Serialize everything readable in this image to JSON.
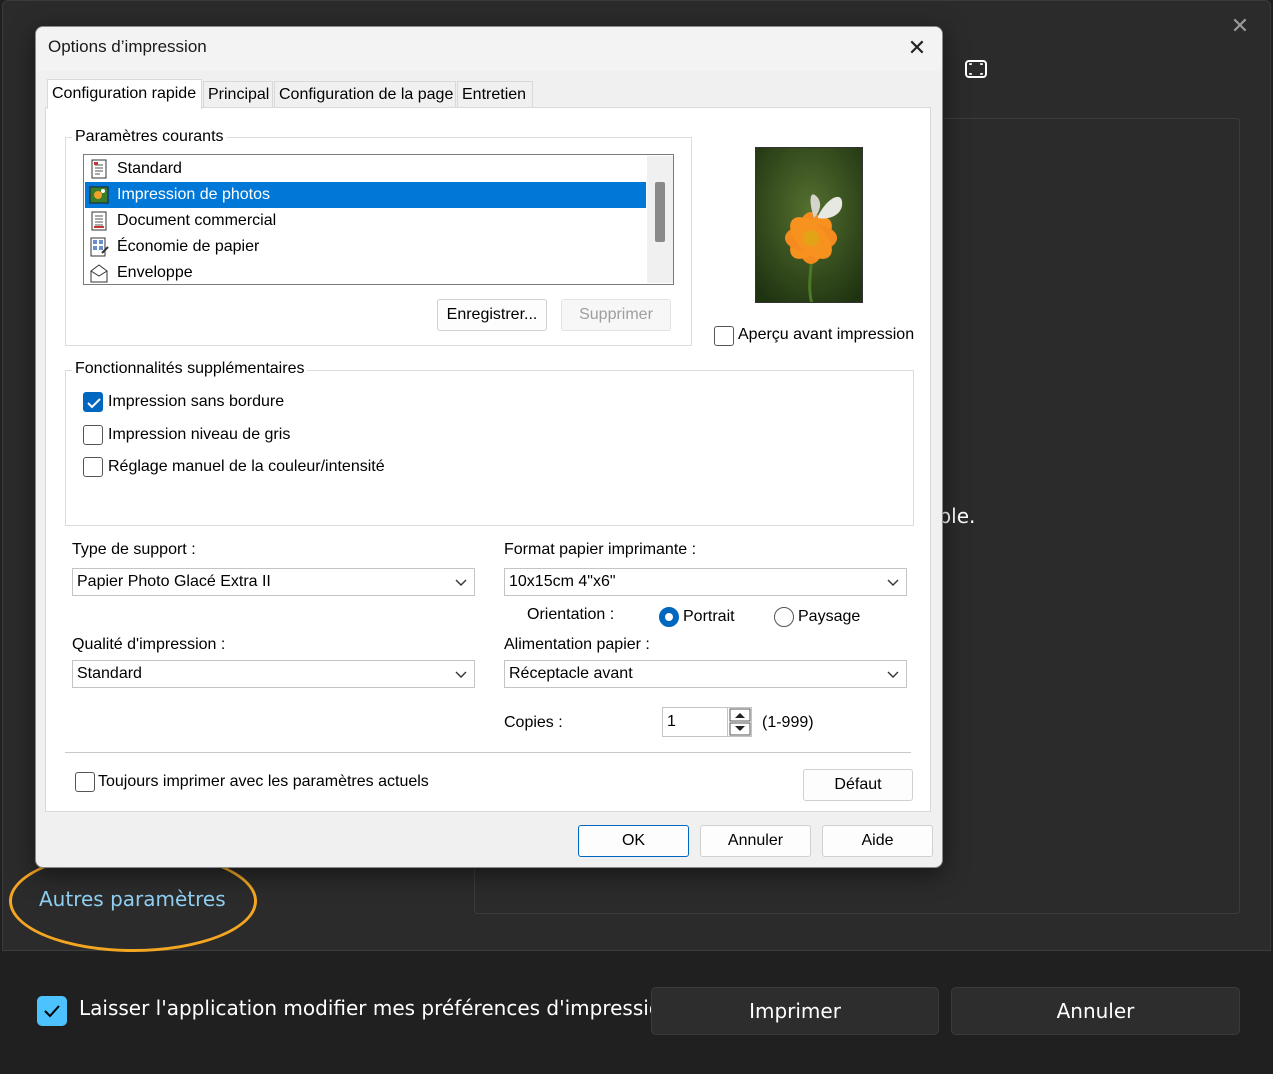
{
  "background": {
    "partial_message": "onible.",
    "other_settings_link": "Autres paramètres",
    "allow_app_label": "Laisser l'application modifier mes préférences d'impression",
    "print_button": "Imprimer",
    "cancel_button": "Annuler",
    "accent_color": "#4cc2ff",
    "highlight_color": "#f4a623"
  },
  "dialog": {
    "title": "Options d’impression",
    "tabs": [
      {
        "label": "Configuration rapide",
        "active": true
      },
      {
        "label": "Principal",
        "active": false
      },
      {
        "label": "Configuration de la page",
        "active": false
      },
      {
        "label": "Entretien",
        "active": false
      }
    ],
    "current_settings": {
      "group_label": "Paramètres courants",
      "items": [
        {
          "label": "Standard",
          "icon": "document-icon",
          "selected": false
        },
        {
          "label": "Impression de photos",
          "icon": "photo-icon",
          "selected": true
        },
        {
          "label": "Document commercial",
          "icon": "business-document-icon",
          "selected": false
        },
        {
          "label": "Économie de papier",
          "icon": "paper-saving-icon",
          "selected": false
        },
        {
          "label": "Enveloppe",
          "icon": "envelope-icon",
          "selected": false
        }
      ],
      "save_button": "Enregistrer...",
      "delete_button": "Supprimer"
    },
    "preview_checkbox": {
      "label": "Aperçu avant impression",
      "checked": false
    },
    "features": {
      "group_label": "Fonctionnalités supplémentaires",
      "items": [
        {
          "label": "Impression sans bordure",
          "checked": true
        },
        {
          "label": "Impression niveau de gris",
          "checked": false
        },
        {
          "label": "Réglage manuel de la couleur/intensité",
          "checked": false
        }
      ]
    },
    "media_type": {
      "label": "Type de support :",
      "value": "Papier Photo Glacé Extra II"
    },
    "paper_size": {
      "label": "Format papier imprimante :",
      "value": "10x15cm 4\"x6\""
    },
    "orientation": {
      "label": "Orientation :",
      "portrait": "Portrait",
      "landscape": "Paysage",
      "selected": "portrait"
    },
    "quality": {
      "label": "Qualité d'impression :",
      "value": "Standard"
    },
    "paper_source": {
      "label": "Alimentation papier :",
      "value": "Réceptacle avant"
    },
    "copies": {
      "label": "Copies :",
      "value": "1",
      "range": "(1-999)"
    },
    "always_print": {
      "label": "Toujours imprimer avec les paramètres actuels",
      "checked": false
    },
    "default_button": "Défaut",
    "ok_button": "OK",
    "cancel_button": "Annuler",
    "help_button": "Aide",
    "selection_color": "#0078d7"
  }
}
